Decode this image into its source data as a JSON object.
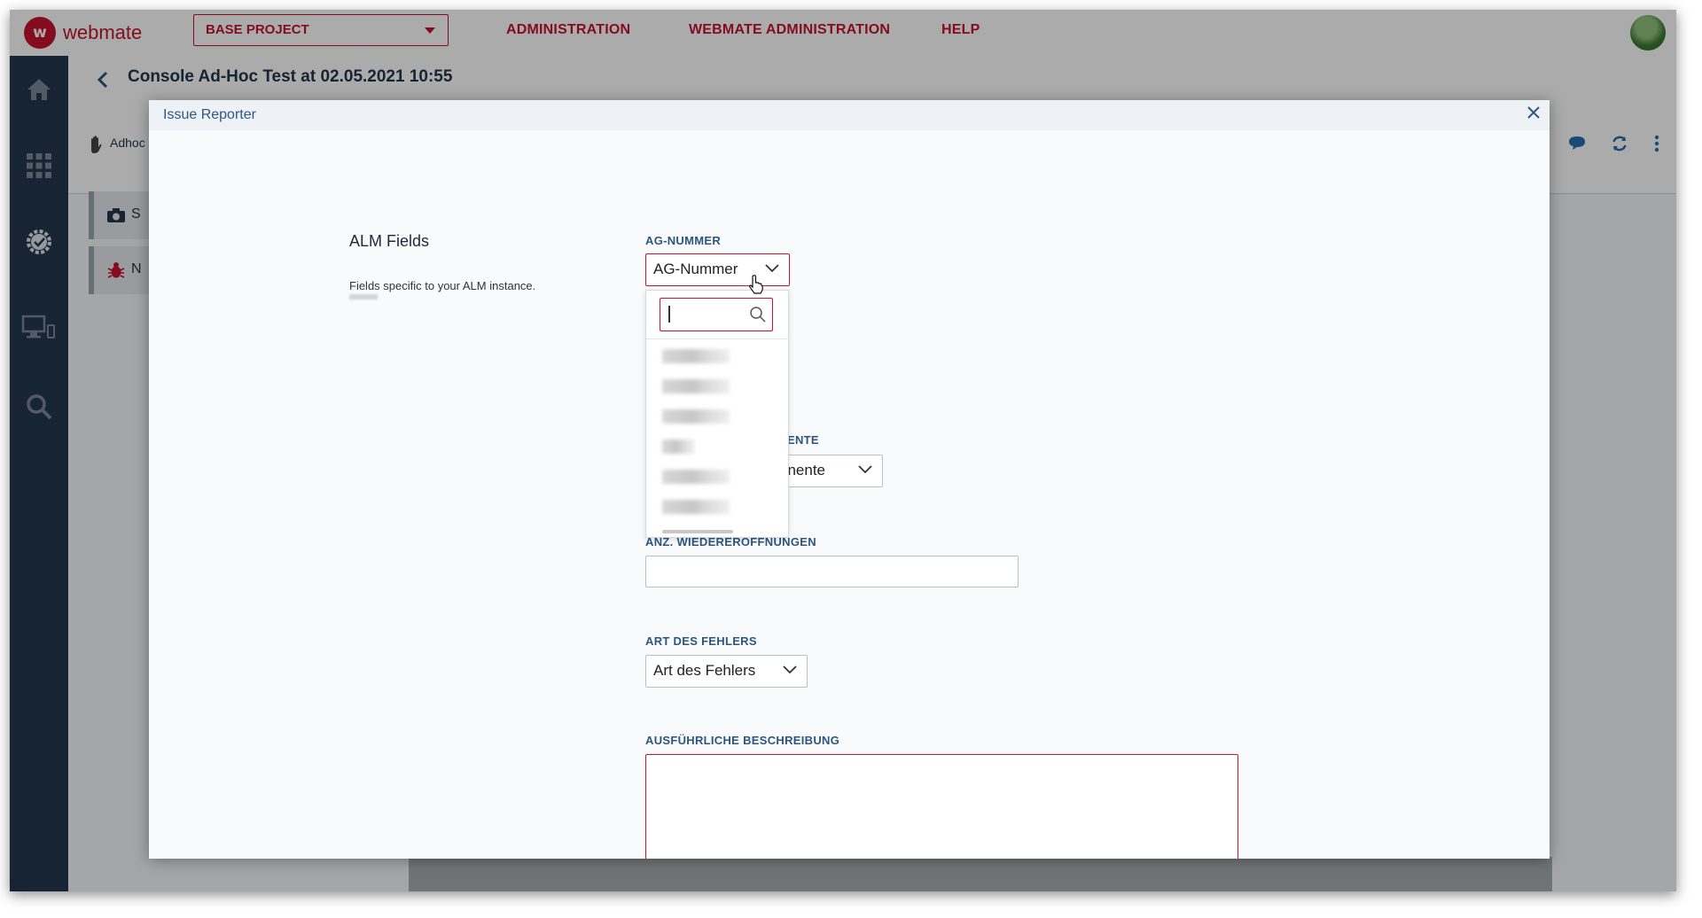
{
  "topbar": {
    "logo_text": "webmate",
    "logo_mark": "w",
    "project_select": "BASE PROJECT",
    "nav": [
      "ADMINISTRATION",
      "WEBMATE ADMINISTRATION",
      "HELP"
    ]
  },
  "sidebar": {
    "icons": [
      "home-icon",
      "apps-grid-icon",
      "settings-check-icon",
      "devices-icon",
      "search-icon"
    ]
  },
  "page": {
    "title": "Console Ad-Hoc Test at 02.05.2021 10:55",
    "toolbar_label": "Adhoc",
    "panel_items": [
      "S",
      "N"
    ]
  },
  "modal": {
    "title": "Issue Reporter",
    "section_title": "ALM Fields",
    "section_desc": "Fields specific to your ALM instance.",
    "fields": {
      "ag_nummer": {
        "label": "AG-NUMMER",
        "value": "AG-Nummer"
      },
      "komponente": {
        "label_visible": "ENTE",
        "value_visible": "onente"
      },
      "wiedereroeffnungen": {
        "label": "ANZ. WIEDERERÖFFNUNGEN",
        "value": ""
      },
      "art_des_fehlers": {
        "label": "ART DES FEHLERS",
        "value": "Art des Fehlers"
      },
      "beschreibung": {
        "label": "AUSFÜHRLICHE BESCHREIBUNG",
        "value": ""
      }
    },
    "dropdown": {
      "search_value": "",
      "option_count_visible": 6,
      "options_redacted": true
    }
  },
  "colors": {
    "brand": "#c4142f",
    "sidebar": "#23364c",
    "label": "#2c5680"
  }
}
